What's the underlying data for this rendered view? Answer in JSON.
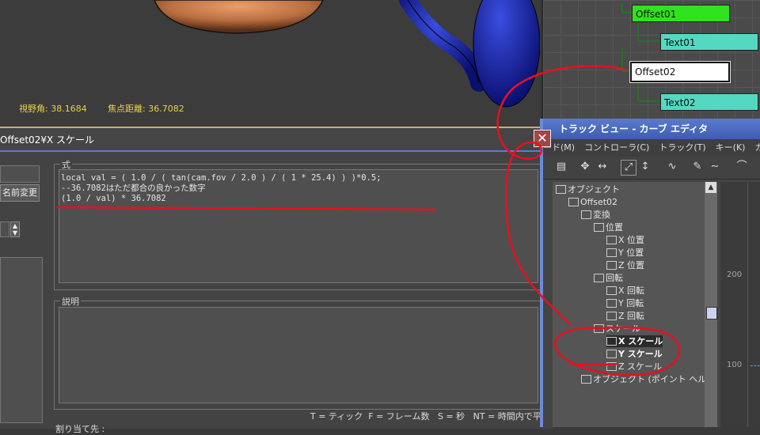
{
  "viewport": {
    "fov_label": "視野角: 38.1684",
    "focal_label": "焦点距離: 36.7082"
  },
  "schematic": {
    "nodes": [
      "Offset01",
      "Text01",
      "Offset02",
      "Text02"
    ]
  },
  "expr_dialog": {
    "title": "Offset02¥X スケール",
    "rename_button": "名前変更",
    "expression_group_label": "式",
    "expression_lines": [
      "local val = ( 1.0 / ( tan(cam.fov / 2.0 ) / ( 1 * 25.4) ) )*0.5;",
      "--36.7082はただ都合の良かった数字",
      "(1.0 / val) * 36.7082"
    ],
    "description_group_label": "説明",
    "time_hint": "T = ティック  F = フレーム数   S = 秒   NT = 時間内で平均化",
    "bottom_label": "割り当て先 :",
    "close_glyph": "✕"
  },
  "trackview": {
    "title": "トラック ビュー - カーブ エディタ",
    "menu": [
      "ード(M)",
      "コントローラ(C)",
      "トラック(T)",
      "キー(K)",
      "カー"
    ],
    "tree": [
      {
        "label": "オブジェクト",
        "indent": 0,
        "bold": false
      },
      {
        "label": "Offset02",
        "indent": 1,
        "bold": false
      },
      {
        "label": "変換",
        "indent": 2,
        "bold": false
      },
      {
        "label": "位置",
        "indent": 3,
        "bold": false
      },
      {
        "label": "X 位置",
        "indent": 4,
        "bold": false
      },
      {
        "label": "Y 位置",
        "indent": 4,
        "bold": false
      },
      {
        "label": "Z 位置",
        "indent": 4,
        "bold": false
      },
      {
        "label": "回転",
        "indent": 3,
        "bold": false
      },
      {
        "label": "X 回転",
        "indent": 4,
        "bold": false
      },
      {
        "label": "Y 回転",
        "indent": 4,
        "bold": false
      },
      {
        "label": "Z 回転",
        "indent": 4,
        "bold": false
      },
      {
        "label": "スケール",
        "indent": 3,
        "bold": false
      },
      {
        "label": "X スケール",
        "indent": 4,
        "bold": true
      },
      {
        "label": "Y スケール",
        "indent": 4,
        "bold": true
      },
      {
        "label": "Z スケール",
        "indent": 4,
        "bold": false
      },
      {
        "label": "オブジェクト (ポイント ヘルパー)",
        "indent": 2,
        "bold": false
      }
    ],
    "axis_values": [
      "200",
      "100"
    ]
  },
  "colors": {
    "annotation": "#e8101e",
    "node_green": "#31e21f",
    "node_teal": "#54d8c2",
    "title_blue": "#4a6cc4"
  }
}
